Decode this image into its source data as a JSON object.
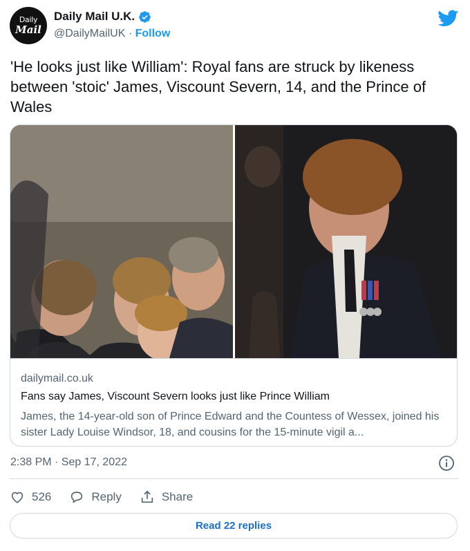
{
  "account": {
    "avatar_line1": "Daily",
    "avatar_line2": "Mail",
    "name": "Daily Mail U.K.",
    "handle": "@DailyMailUK",
    "separator": "·",
    "follow_label": "Follow"
  },
  "tweet": {
    "text": "'He looks just like William': Royal fans are struck by likeness between 'stoic' James, Viscount Severn, 14, and the Prince of Wales",
    "timestamp": "2:38 PM · Sep 17, 2022"
  },
  "card": {
    "domain": "dailymail.co.uk",
    "title": "Fans say James, Viscount Severn looks just like Prince William",
    "description": "James, the 14-year-old son of Prince Edward and the Countess of Wessex, joined his sister Lady Louise Windsor, 18, and cousins for the 15-minute vigil a..."
  },
  "actions": {
    "like_count": "526",
    "reply_label": "Reply",
    "share_label": "Share"
  },
  "footer": {
    "read_replies_label": "Read 22 replies"
  },
  "colors": {
    "twitter_blue": "#1d9bf0",
    "link_blue": "#1d6ec5",
    "muted_text": "#536471",
    "border": "#cfd9de"
  },
  "icons": [
    "daily-mail-logo",
    "verified-badge-icon",
    "twitter-bird-icon",
    "info-icon",
    "heart-icon",
    "reply-icon",
    "share-icon"
  ]
}
